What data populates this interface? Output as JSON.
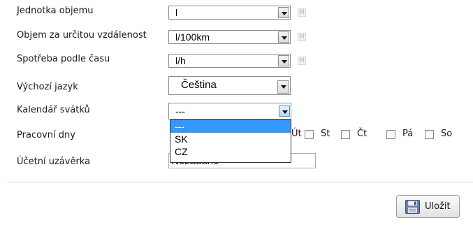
{
  "form": {
    "rows": [
      {
        "label": "Jednotka objemu",
        "value": "l"
      },
      {
        "label": "Objem za určitou vzdálenost",
        "value": "l/100km"
      },
      {
        "label": "Spotřeba podle času",
        "value": "l/h"
      },
      {
        "label": "Výchozí jazyk",
        "value": "Čeština"
      },
      {
        "label": "Kalendář svátků",
        "value": "---"
      },
      {
        "label": "Pracovní dny"
      },
      {
        "label": "Účetní uzávěrka",
        "value": "Nezadáno"
      }
    ],
    "unit_button": "H",
    "workdays": [
      {
        "label": "Út",
        "checked": false
      },
      {
        "label": "St",
        "checked": false
      },
      {
        "label": "Čt",
        "checked": false
      },
      {
        "label": "Pá",
        "checked": false
      },
      {
        "label": "So",
        "checked": false
      }
    ],
    "holiday_dropdown": {
      "options": [
        "---",
        "SK",
        "CZ"
      ],
      "highlighted": "---"
    }
  },
  "footer": {
    "save_label": "Uložit",
    "save_icon": "floppy-disk-icon"
  },
  "colors": {
    "highlight": "#3399ff"
  }
}
